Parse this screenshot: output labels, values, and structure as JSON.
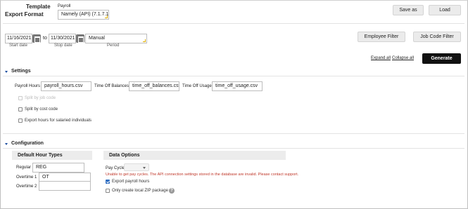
{
  "header": {
    "template_label": "Template",
    "template_value": "Payroll",
    "export_format_label": "Export Format",
    "export_format_value": "Namely (API) (7.1.7.13)",
    "save_as_label": "Save as",
    "load_label": "Load"
  },
  "dates": {
    "start_value": "11/16/2021",
    "to_label": "to",
    "stop_value": "11/30/2021",
    "period_value": "Manual",
    "start_caption": "Start date",
    "stop_caption": "Stop date",
    "period_caption": "Period"
  },
  "filters": {
    "employee_filter_label": "Employee Filter",
    "job_code_filter_label": "Job Code Filter"
  },
  "actions": {
    "expand_all": "Expand all",
    "collapse_all": "Collapse all",
    "generate": "Generate"
  },
  "settings": {
    "title": "Settings",
    "payroll_hours_label": "Payroll Hours",
    "payroll_hours_value": "payroll_hours.csv",
    "time_off_balances_label": "Time Off Balances",
    "time_off_balances_value": "time_off_balances.csv",
    "time_off_usage_label": "Time Off Usage",
    "time_off_usage_value": "time_off_usage.csv",
    "split_job_code": "Split by job code",
    "split_cost_code": "Split by cost code",
    "export_hours_salaried": "Export hours for salaried individuals"
  },
  "configuration": {
    "title": "Configuration",
    "default_hour_types": {
      "title": "Default Hour Types",
      "regular_label": "Regular",
      "regular_value": "REG",
      "overtime1_label": "Overtime 1",
      "overtime1_value": "OT",
      "overtime2_label": "Overtime 2",
      "overtime2_value": ""
    },
    "data_options": {
      "title": "Data Options",
      "pay_cycle_label": "Pay Cycle",
      "error_message": "Unable to get pay cycles. The API connection settings stored in the database are invalid. Please contact support.",
      "export_payroll_hours": "Export payroll hours",
      "only_create_zip": "Only create local ZIP package",
      "help_glyph": "?"
    }
  },
  "colors": {
    "generate_bg": "#111111",
    "error_text": "#c0392b",
    "checkbox_on": "#2d6cc0"
  }
}
